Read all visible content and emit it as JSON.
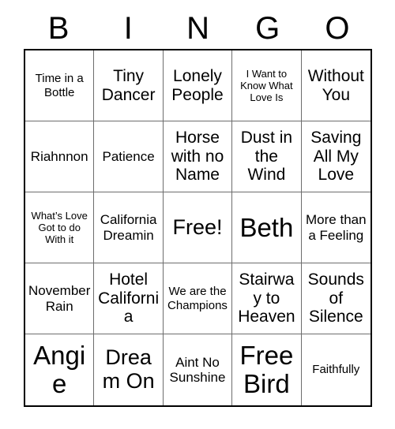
{
  "card": {
    "title": "BINGO",
    "header_letters": [
      "B",
      "I",
      "N",
      "G",
      "O"
    ],
    "free_space_label": "Free!",
    "colors": {
      "text": "#000000",
      "background": "#ffffff",
      "outer_border": "#000000",
      "inner_gridline": "#6d6d6d"
    },
    "rows": [
      [
        {
          "text": "Time in a Bottle",
          "size": "sm"
        },
        {
          "text": "Tiny Dancer",
          "size": "lg"
        },
        {
          "text": "Lonely People",
          "size": "lg"
        },
        {
          "text": "I Want to Know What Love Is",
          "size": "xs"
        },
        {
          "text": "Without You",
          "size": "lg"
        }
      ],
      [
        {
          "text": "Riahnnon",
          "size": "md"
        },
        {
          "text": "Patience",
          "size": "md"
        },
        {
          "text": "Horse with no Name",
          "size": "lg"
        },
        {
          "text": "Dust in the Wind",
          "size": "lg"
        },
        {
          "text": "Saving All My Love",
          "size": "lg"
        }
      ],
      [
        {
          "text": "What’s Love Got to do With it",
          "size": "xs"
        },
        {
          "text": "California Dreamin",
          "size": "md"
        },
        {
          "text": "Free!",
          "size": "xl"
        },
        {
          "text": "Beth",
          "size": "xxl"
        },
        {
          "text": "More than a Feeling",
          "size": "md"
        }
      ],
      [
        {
          "text": "November Rain",
          "size": "md"
        },
        {
          "text": "Hotel California",
          "size": "lg"
        },
        {
          "text": "We are the Champions",
          "size": "sm"
        },
        {
          "text": "Stairway to Heaven",
          "size": "lg"
        },
        {
          "text": "Sounds of Silence",
          "size": "lg"
        }
      ],
      [
        {
          "text": "Angie",
          "size": "xxl"
        },
        {
          "text": "Dream On",
          "size": "xl"
        },
        {
          "text": "Aint No Sunshine",
          "size": "md"
        },
        {
          "text": "Free Bird",
          "size": "xxl"
        },
        {
          "text": "Faithfully",
          "size": "sm"
        }
      ]
    ]
  }
}
